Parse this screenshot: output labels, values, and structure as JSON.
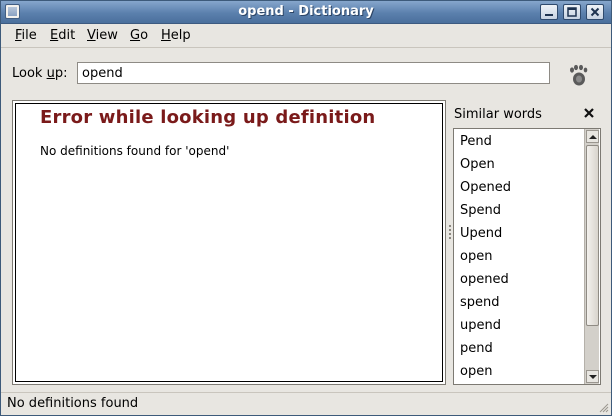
{
  "window": {
    "title": "opend - Dictionary"
  },
  "menu": [
    {
      "mnemonic": "F",
      "rest": "ile"
    },
    {
      "mnemonic": "E",
      "rest": "dit"
    },
    {
      "mnemonic": "V",
      "rest": "iew"
    },
    {
      "mnemonic": "G",
      "rest": "o"
    },
    {
      "mnemonic": "H",
      "rest": "elp"
    }
  ],
  "lookup": {
    "label_pre": "Look ",
    "label_mnemonic": "u",
    "label_post": "p:",
    "value": "opend"
  },
  "definition": {
    "title": "Error while looking up definition",
    "message": "No definitions found for 'opend'"
  },
  "sidebar": {
    "title": "Similar words",
    "items": [
      "Pend",
      "Open",
      "Opened",
      "Spend",
      "Upend",
      "open",
      "opened",
      "spend",
      "upend",
      "pend",
      "open"
    ]
  },
  "status": {
    "text": "No definitions found"
  },
  "colors": {
    "error_title": "#7a1a1a",
    "titlebar": "#5b80ad"
  }
}
